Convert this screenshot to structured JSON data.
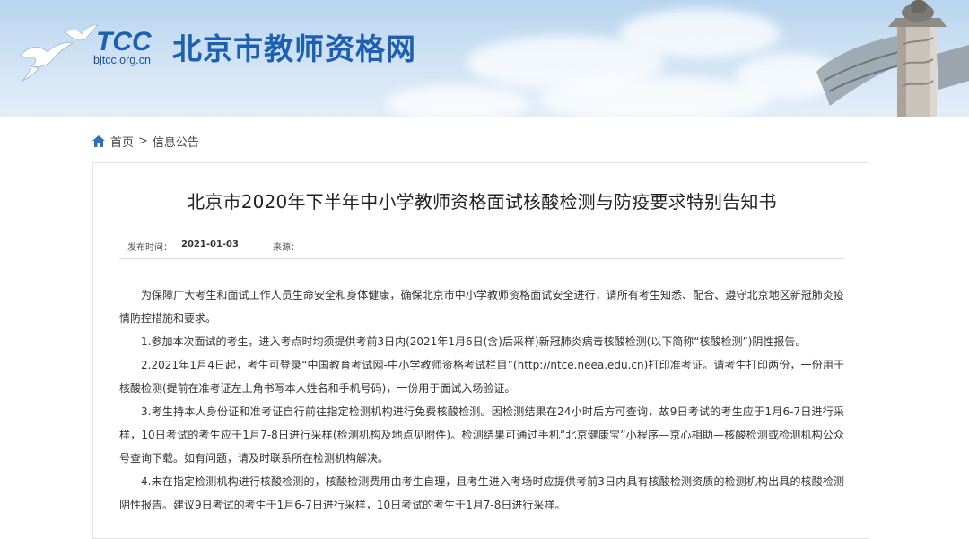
{
  "header": {
    "site_title": "北京市教师资格网",
    "logo_text": "TCC",
    "logo_url": "bjtcc.org.cn"
  },
  "breadcrumb": {
    "home_label": "首页",
    "separator": ">",
    "current_label": "信息公告"
  },
  "article": {
    "title": "北京市2020年下半年中小学教师资格面试核酸检测与防疫要求特别告知书",
    "publish_label": "发布时间：",
    "publish_date": "2021-01-03",
    "source_label": "来源：",
    "source_value": "",
    "paragraphs": [
      "为保障广大考生和面试工作人员生命安全和身体健康，确保北京市中小学教师资格面试安全进行，请所有考生知悉、配合、遵守北京地区新冠肺炎疫情防控措施和要求。",
      "1.参加本次面试的考生，进入考点时均须提供考前3日内(2021年1月6日(含)后采样)新冠肺炎病毒核酸检测(以下简称“核酸检测”)阴性报告。",
      "2.2021年1月4日起，考生可登录“中国教育考试网-中小学教师资格考试栏目”(http://ntce.neea.edu.cn)打印准考证。请考生打印两份，一份用于核酸检测(提前在准考证左上角书写本人姓名和手机号码)，一份用于面试入场验证。",
      "3.考生持本人身份证和准考证自行前往指定检测机构进行免费核酸检测。因检测结果在24小时后方可查询，故9日考试的考生应于1月6-7日进行采样，10日考试的考生应于1月7-8日进行采样(检测机构及地点见附件)。检测结果可通过手机“北京健康宝”小程序—京心相助—核酸检测或检测机构公众号查询下载。如有问题，请及时联系所在检测机构解决。",
      "4.未在指定检测机构进行核酸检测的，核酸检测费用由考生自理，且考生进入考场时应提供考前3日内具有核酸检测资质的检测机构出具的核酸检测阴性报告。建议9日考试的考生于1月6-7日进行采样，10日考试的考生于1月7-8日进行采样。"
    ]
  },
  "colors": {
    "brand_blue": "#1d5fb0",
    "banner_sky": "#c4dcf2",
    "home_icon": "#2f6fc0"
  }
}
